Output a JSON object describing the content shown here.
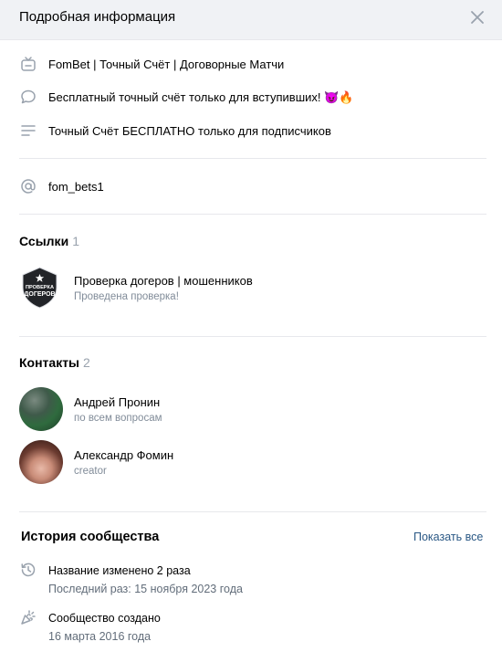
{
  "header": {
    "title": "Подробная информация"
  },
  "info": {
    "name": "FomBet | Точный Счёт | Договорные Матчи",
    "status": "Бесплатный точный счёт только для вступивших! 😈🔥",
    "description": "Точный Счёт БЕСПЛАТНО только для подписчиков",
    "handle": "fom_bets1"
  },
  "links": {
    "title": "Ссылки",
    "count": "1",
    "items": [
      {
        "badge_line1": "ПРОВЕРКА",
        "badge_line2": "ДОГЕРОВ",
        "title": "Проверка догеров | мошенников",
        "subtitle": "Проведена проверка!"
      }
    ]
  },
  "contacts": {
    "title": "Контакты",
    "count": "2",
    "items": [
      {
        "name": "Андрей Пронин",
        "role": "по всем вопросам"
      },
      {
        "name": "Александр Фомин",
        "role": "creator"
      }
    ]
  },
  "history": {
    "title": "История сообщества",
    "show_all": "Показать все",
    "items": [
      {
        "line1": "Название изменено 2 раза",
        "line2": "Последний раз: 15 ноября 2023 года",
        "icon": "history-icon"
      },
      {
        "line1": "Сообщество создано",
        "line2": "16 марта 2016 года",
        "icon": "party-popper-icon"
      }
    ]
  },
  "colors": {
    "accent": "#2a5885",
    "muted": "#818c99",
    "icon": "#99a2ad"
  }
}
